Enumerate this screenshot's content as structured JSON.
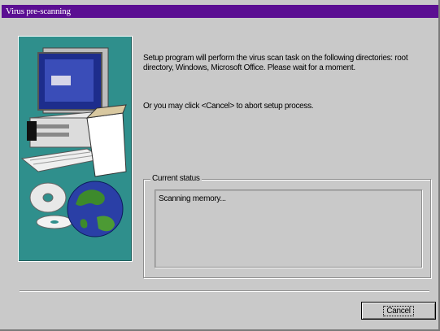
{
  "window": {
    "title": "Virus pre-scanning"
  },
  "message": {
    "line1": "Setup program will perform the virus scan task on the following directories: root directory, Windows, Microsoft Office. Please wait for a moment.",
    "line2": "Or you may click <Cancel> to abort setup process."
  },
  "status": {
    "group_label": "Current status",
    "text": "Scanning memory..."
  },
  "buttons": {
    "cancel_label": "Cancel"
  },
  "colors": {
    "titlebar": "#5b0f92",
    "illustration_bg": "#2f8f8c",
    "dialog_bg": "#c9c9c9"
  },
  "icons": [
    "computer-icon",
    "cd-disc-icon",
    "globe-icon"
  ]
}
